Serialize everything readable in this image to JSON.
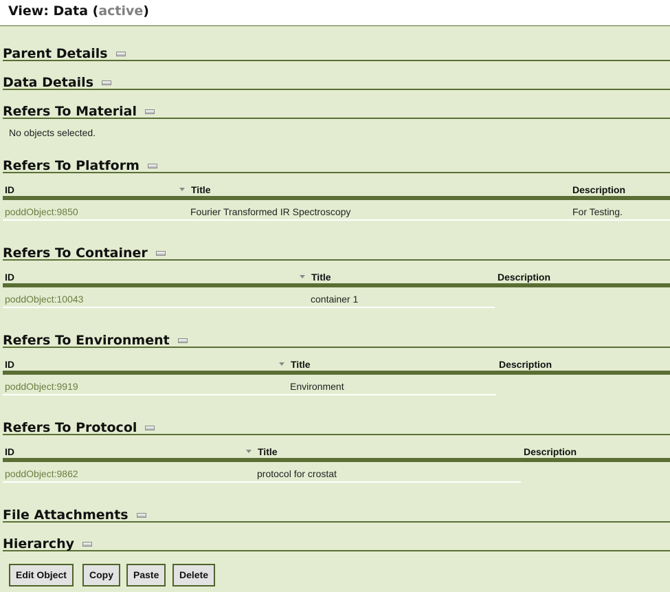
{
  "header": {
    "view_label": "View: Data (",
    "status": "active",
    "close_paren": ")"
  },
  "sections": {
    "parent_details": "Parent Details",
    "data_details": "Data Details",
    "refers_material": "Refers To Material",
    "refers_platform": "Refers To Platform",
    "refers_container": "Refers To Container",
    "refers_environment": "Refers To Environment",
    "refers_protocol": "Refers To Protocol",
    "file_attachments": "File Attachments",
    "hierarchy": "Hierarchy"
  },
  "material": {
    "empty_text": "No objects selected."
  },
  "columns": {
    "id": "ID",
    "title": "Title",
    "description": "Description"
  },
  "platform": {
    "rows": [
      {
        "id": "poddObject:9850",
        "title": "Fourier Transformed IR Spectroscopy",
        "description": "For Testing."
      }
    ]
  },
  "container": {
    "rows": [
      {
        "id": "poddObject:10043",
        "title": "container 1",
        "description": ""
      }
    ]
  },
  "environment": {
    "rows": [
      {
        "id": "poddObject:9919",
        "title": "Environment",
        "description": ""
      }
    ]
  },
  "protocol": {
    "rows": [
      {
        "id": "poddObject:9862",
        "title": "protocol for crostat",
        "description": ""
      }
    ]
  },
  "actions": {
    "edit": "Edit Object",
    "copy": "Copy",
    "paste": "Paste",
    "delete": "Delete"
  }
}
